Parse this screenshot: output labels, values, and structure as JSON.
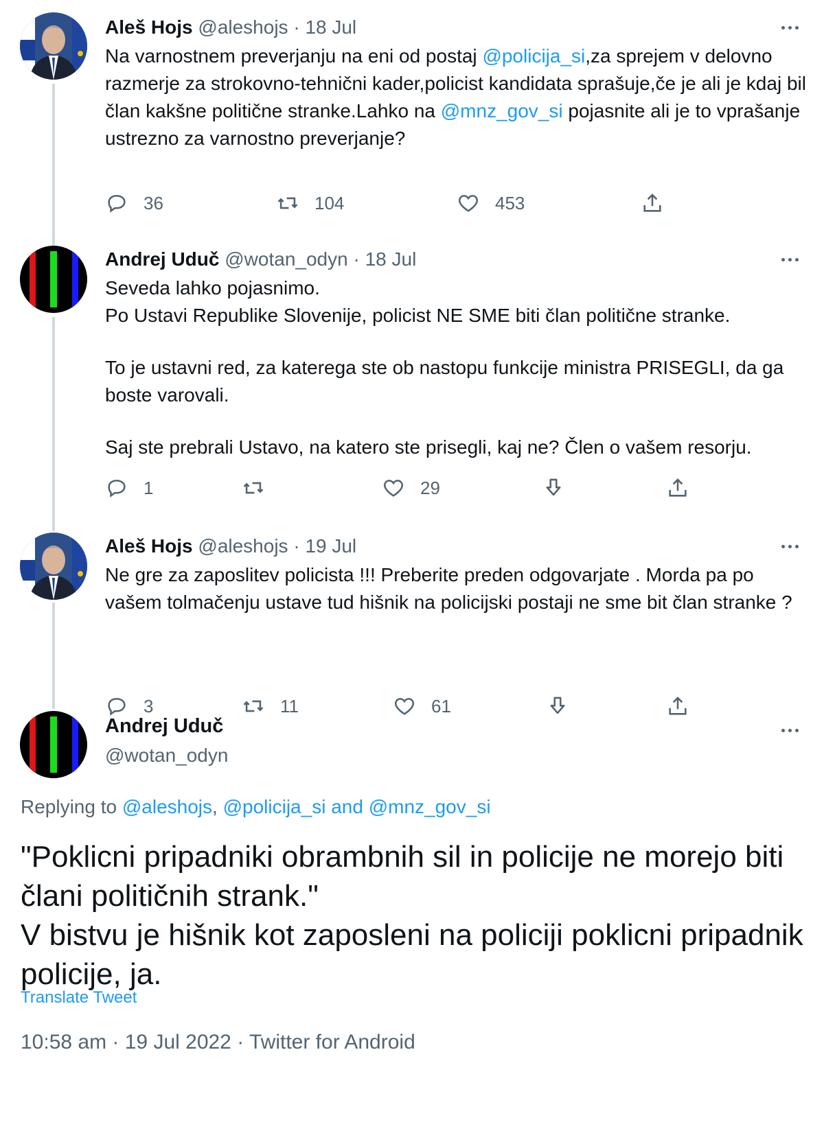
{
  "tweets": [
    {
      "name": "Aleš Hojs",
      "handle": "@aleshojs",
      "dot": " · ",
      "date": "18 Jul",
      "text": {
        "l1_a": "Na varnostnem preverjanju na eni od postaj ",
        "l1_link": "@policija_si",
        "l1_b": ",za sprejem v delovno razmerje za strokovno-tehnični kader,policist kandidata sprašuje,če je ali je kdaj bil član kakšne politične stranke.Lahko na ",
        "l2_link": "@mnz_gov_si",
        "l2_b": " pojasnite ali je to vprašanje ustrezno za varnostno preverjanje?"
      },
      "replies": "36",
      "retweets": "104",
      "likes": "453"
    },
    {
      "name": "Andrej Uduč",
      "handle": "@wotan_odyn",
      "dot": " · ",
      "date": "18 Jul",
      "paragraphs": [
        "Seveda lahko pojasnimo.",
        "Po Ustavi Republike Slovenije, policist NE SME biti član politične stranke.",
        "To je ustavni red, za katerega ste ob nastopu funkcije ministra PRISEGLI, da ga boste varovali.",
        "Saj ste prebrali Ustavo, na katero ste prisegli, kaj ne? Člen o vašem resorju."
      ],
      "replies": "1",
      "retweets": "",
      "likes": "29"
    },
    {
      "name": "Aleš Hojs",
      "handle": "@aleshojs",
      "dot": " · ",
      "date": "19 Jul",
      "text": "Ne gre za zaposlitev policista !!! Preberite preden odgovarjate . Morda pa po vašem tolmačenju ustave tud hišnik na policijski postaji ne sme bit član stranke ?",
      "replies": "3",
      "retweets": "11",
      "likes": "61"
    }
  ],
  "main_tweet": {
    "name": "Andrej Uduč",
    "handle": "@wotan_odyn",
    "replying_prefix": "Replying to ",
    "reply_to_1": "@aleshojs",
    "sep_1": ", ",
    "reply_to_2": "@policija_si",
    "sep_2": " and ",
    "reply_to_3": "@mnz_gov_si",
    "paragraphs": [
      "\"Poklicni pripadniki obrambnih sil in policije ne morejo biti člani političnih strank.\"",
      "V bistvu je hišnik kot zaposleni na policiji poklicni pripadnik policije, ja."
    ],
    "translate_label": "Translate Tweet",
    "timestamp": "10:58 am · 19 Jul 2022 · Twitter for Android"
  },
  "colors": {
    "link": "#1d9bf0",
    "secondary_text": "#536471",
    "thread_line": "#cfd9de"
  },
  "icons": [
    "reply-icon",
    "retweet-icon",
    "like-icon",
    "share-icon",
    "download-icon",
    "more-icon"
  ]
}
